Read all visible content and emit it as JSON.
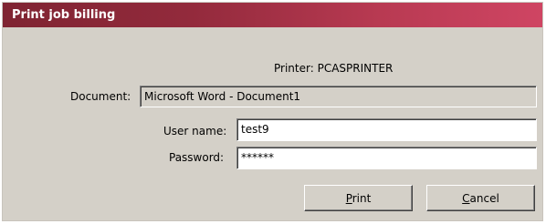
{
  "window": {
    "title": "Print job billing"
  },
  "printer": {
    "label": "Printer:",
    "name": "PCASPRINTER"
  },
  "document": {
    "label": "Document:",
    "value": "Microsoft Word - Document1"
  },
  "user": {
    "label": "User name:",
    "value": "test9"
  },
  "password": {
    "label": "Password:",
    "value": "******"
  },
  "buttons": {
    "print_label": "Print",
    "cancel_label": "Cancel"
  },
  "colors": {
    "titlebar_start": "#7f2432",
    "titlebar_end": "#cf4563",
    "dialog_bg": "#d4d0c8"
  }
}
